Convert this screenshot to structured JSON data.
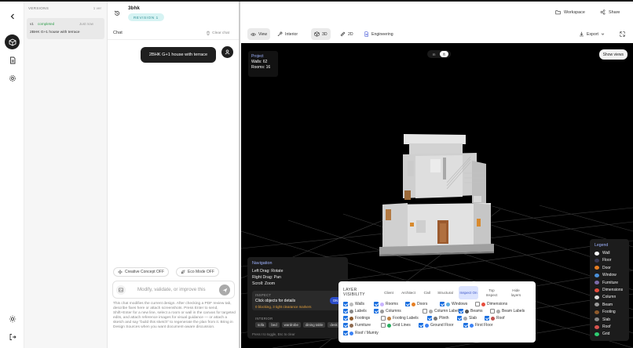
{
  "app": {
    "project_title": "3bhk",
    "revision_badge": "REVISION 1",
    "header_buttons": {
      "workspace": "Workspace",
      "share": "Share"
    }
  },
  "versions": {
    "title": "VERSIONS",
    "count": "1 ver",
    "items": [
      {
        "version": "v1",
        "status": "completed",
        "time": "Just now",
        "name": "2BHK G+1 house with terrace"
      }
    ]
  },
  "chat": {
    "title": "Chat",
    "clear_label": "Clear chat",
    "messages": [
      {
        "role": "user",
        "text": "2BHK G+1 house with terrace"
      }
    ],
    "chips": {
      "creative": "Creative Concept OFF",
      "eco": "Eco Mode OFF"
    },
    "input_placeholder": "Modify, validate, or improve this",
    "help_text": "This chat modifies the current design. After checking a PDF review tab, describe fixes here or attach screenshots. Press Enter to send, Shift+Enter for a new line, select a room or wall in the canvas for targeted edits, and attach reference images for visual guidance — or attach a sketch and say \"build this sketch\" to regenerate the plan from it. Bring in Design Sources when you want document-aware discussion."
  },
  "viewer_toolbar": {
    "view": "View",
    "interior": "Interior",
    "mode_3d": "3D",
    "mode_2d": "2D",
    "engineering": "Engineering",
    "export": "Export"
  },
  "project_info": {
    "title": "Project",
    "walls": "Walls: 62",
    "rooms": "Rooms: 16"
  },
  "unit_toggle": {
    "m": "m",
    "ft": "ft",
    "selected": "ft"
  },
  "show_views": "Show views",
  "navigation": {
    "title": "Navigation",
    "left_drag": "Left Drag: Rotate",
    "right_drag": "Right Drag: Pan",
    "scroll": "Scroll: Zoom",
    "inspect_label": "INSPECT",
    "inspect_text": "Click objects for details",
    "inspect_status": "0 blocking, 3 tight clearance markers",
    "inspect_toggle": "ON",
    "interior_label": "INTERIOR",
    "interior_items": [
      "sofa",
      "bed",
      "wardrobe",
      "dining table",
      "desk"
    ],
    "hint": "Press I to toggle, Esc to clear"
  },
  "layers": {
    "title": "LAYER VISIBILITY",
    "presets": [
      "Client",
      "Architect",
      "Civil",
      "Structural",
      "Inspect On",
      "Top Inspect",
      "Hide layers"
    ],
    "items": [
      {
        "label": "Walls",
        "on": true,
        "color": "#bbbbbb"
      },
      {
        "label": "Rooms",
        "on": true,
        "color": "#c9b3ff"
      },
      {
        "label": "Doors",
        "on": true,
        "color": "#e67e22"
      },
      {
        "label": "Windows",
        "on": true,
        "color": "#5dade2"
      },
      {
        "label": "Dimensions",
        "on": false,
        "color": "#e74c3c"
      },
      {
        "label": "Labels",
        "on": true,
        "color": "#888888"
      },
      {
        "label": "Columns",
        "on": true,
        "color": "#999999"
      },
      {
        "label": "Column Labels",
        "on": false,
        "color": "#aaaaaa"
      },
      {
        "label": "Beams",
        "on": true,
        "color": "#555555"
      },
      {
        "label": "Beam Labels",
        "on": false,
        "color": "#aaaaaa"
      },
      {
        "label": "Footings",
        "on": true,
        "color": "#8e5a2b"
      },
      {
        "label": "Footing Labels",
        "on": false,
        "color": "#c08040"
      },
      {
        "label": "Plinth",
        "on": true,
        "color": "#777777"
      },
      {
        "label": "Slab",
        "on": true,
        "color": "#aaaaaa"
      },
      {
        "label": "Roof",
        "on": true,
        "color": "#c0504d"
      },
      {
        "label": "Furniture",
        "on": true,
        "color": "#8e6a4f"
      },
      {
        "label": "Grid Lines",
        "on": false,
        "color": "#27ae60"
      },
      {
        "label": "Ground Floor",
        "on": true,
        "color": "#3b82f6"
      },
      {
        "label": "First Floor",
        "on": true,
        "color": "#3b82f6"
      },
      {
        "label": "Roof / Mumty",
        "on": true,
        "color": "#3b82f6"
      }
    ]
  },
  "legend": {
    "title": "Legend",
    "items": [
      {
        "label": "Wall",
        "color": "#ffffff"
      },
      {
        "label": "Floor",
        "color": "#3a3a55"
      },
      {
        "label": "Door",
        "color": "#e67e22"
      },
      {
        "label": "Window",
        "color": "#4a90d9"
      },
      {
        "label": "Furniture",
        "color": "#7a6aa8"
      },
      {
        "label": "Dimensions",
        "color": "#e74c3c"
      },
      {
        "label": "Column",
        "color": "#dddddd"
      },
      {
        "label": "Beam",
        "color": "#999999"
      },
      {
        "label": "Footing",
        "color": "#8e5a2b"
      },
      {
        "label": "Slab",
        "color": "#888888"
      },
      {
        "label": "Roof",
        "color": "#d9534f"
      },
      {
        "label": "Grid",
        "color": "#2ecc71"
      }
    ]
  }
}
